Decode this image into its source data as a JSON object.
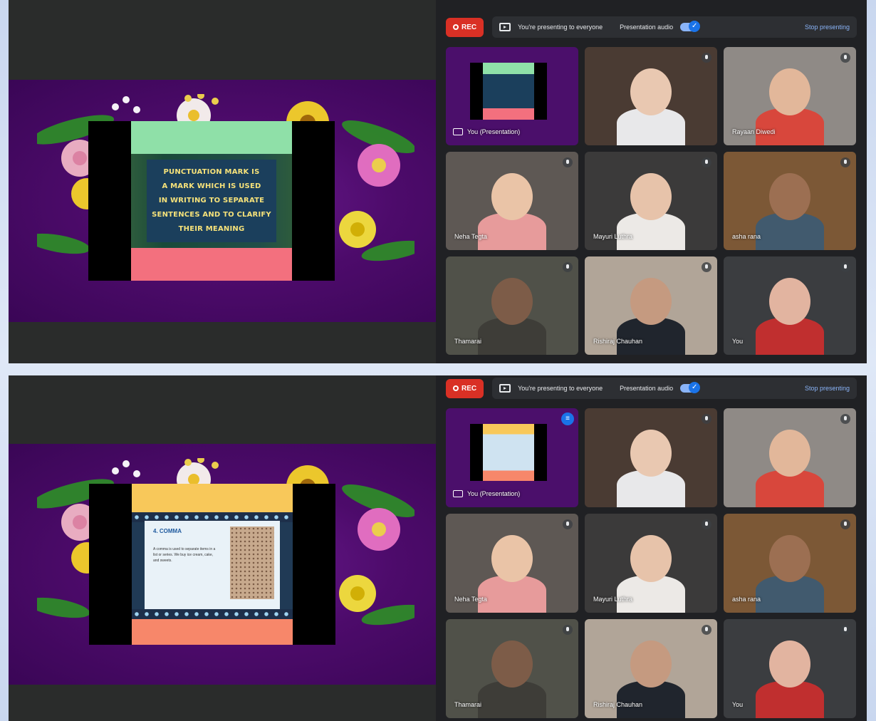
{
  "colors": {
    "rec_red": "#d93025",
    "accent_blue": "#8ab4f8",
    "meet_bg": "#202124",
    "slide_purple": "#4d0b6b"
  },
  "screens": [
    {
      "id": "screen1",
      "slide": {
        "quote": "PUNCTUATION MARK IS\nA MARK WHICH IS USED\nIN WRITING TO SEPARATE\nSENTENCES AND TO CLARIFY\nTHEIR MEANING"
      },
      "topbar": {
        "rec_label": "REC",
        "presenting_text": "You're presenting to everyone",
        "audio_label": "Presentation audio",
        "stop_label": "Stop presenting"
      },
      "tiles": [
        {
          "name": "You (Presentation)",
          "type": "presentation"
        },
        {
          "name": "",
          "type": "person",
          "bg": "#4a3b33",
          "face": "#e9c8b1",
          "body": "#e8e8ea"
        },
        {
          "name": "Rayaan Diwedi",
          "type": "person",
          "bg": "#8f8a86",
          "face": "#e2b79a",
          "body": "#d8473c"
        },
        {
          "name": "Neha Tegta",
          "type": "person",
          "bg": "#5e5854",
          "face": "#eac4a7",
          "body": "#e79b9b"
        },
        {
          "name": "Mayuri Luthra",
          "type": "person",
          "bg": "#3b3a3a",
          "face": "#e7c3aa",
          "body": "#ece9e6"
        },
        {
          "name": "asha rana",
          "type": "person",
          "bg": "#7c5836",
          "face": "#9c6f52",
          "body": "#415a6e"
        },
        {
          "name": "Thamarai",
          "type": "person",
          "bg": "#505149",
          "face": "#7d5c48",
          "body": "#3e3d38"
        },
        {
          "name": "Rishiraj Chauhan",
          "type": "person",
          "bg": "#b1a598",
          "face": "#c59a80",
          "body": "#20252d"
        },
        {
          "name": "You",
          "type": "person",
          "bg": "#3b3d40",
          "face": "#e2b4a0",
          "body": "#c02f2f"
        }
      ]
    },
    {
      "id": "screen2",
      "slide": {
        "doc_title": "4. COMMA",
        "doc_lines": "A comma is used to separate items in a list or series. We buy ice cream, cake, and sweets."
      },
      "topbar": {
        "rec_label": "REC",
        "presenting_text": "You're presenting to everyone",
        "audio_label": "Presentation audio",
        "stop_label": "Stop presenting"
      },
      "tiles": [
        {
          "name": "You (Presentation)",
          "type": "presentation"
        },
        {
          "name": "",
          "type": "person",
          "bg": "#4a3b33",
          "face": "#e9c8b1",
          "body": "#e8e8ea"
        },
        {
          "name": "",
          "type": "person",
          "bg": "#8f8a86",
          "face": "#e2b79a",
          "body": "#d8473c"
        },
        {
          "name": "Neha Tegta",
          "type": "person",
          "bg": "#5e5854",
          "face": "#eac4a7",
          "body": "#e79b9b"
        },
        {
          "name": "Mayuri Luthra",
          "type": "person",
          "bg": "#3b3a3a",
          "face": "#e7c3aa",
          "body": "#ece9e6"
        },
        {
          "name": "asha rana",
          "type": "person",
          "bg": "#7c5836",
          "face": "#9c6f52",
          "body": "#415a6e"
        },
        {
          "name": "Thamarai",
          "type": "person",
          "bg": "#505149",
          "face": "#7d5c48",
          "body": "#3e3d38"
        },
        {
          "name": "Rishiraj Chauhan",
          "type": "person",
          "bg": "#b1a598",
          "face": "#c59a80",
          "body": "#20252d"
        },
        {
          "name": "You",
          "type": "person",
          "bg": "#3b3d40",
          "face": "#e2b4a0",
          "body": "#c02f2f"
        }
      ]
    }
  ]
}
